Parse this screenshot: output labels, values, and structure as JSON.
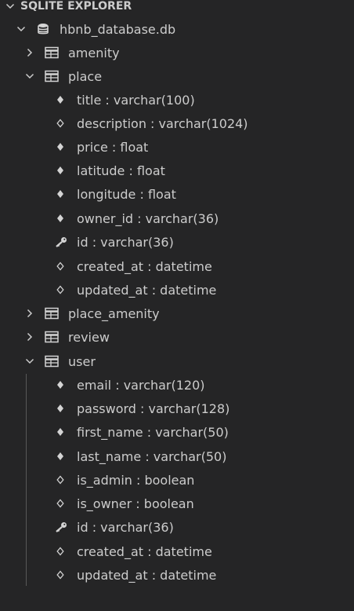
{
  "section": {
    "title": "SQLITE EXPLORER"
  },
  "database": {
    "name": "hbnb_database.db",
    "icon": "database-icon"
  },
  "tables": [
    {
      "name": "amenity",
      "expanded": false,
      "icon": "table-icon"
    },
    {
      "name": "place",
      "expanded": true,
      "icon": "table-icon",
      "columns": [
        {
          "label": "title : varchar(100)",
          "kind": "not-null"
        },
        {
          "label": "description : varchar(1024)",
          "kind": "nullable"
        },
        {
          "label": "price : float",
          "kind": "not-null"
        },
        {
          "label": "latitude : float",
          "kind": "not-null"
        },
        {
          "label": "longitude : float",
          "kind": "not-null"
        },
        {
          "label": "owner_id : varchar(36)",
          "kind": "not-null"
        },
        {
          "label": "id : varchar(36)",
          "kind": "primary-key"
        },
        {
          "label": "created_at : datetime",
          "kind": "nullable"
        },
        {
          "label": "updated_at : datetime",
          "kind": "nullable"
        }
      ]
    },
    {
      "name": "place_amenity",
      "expanded": false,
      "icon": "table-icon"
    },
    {
      "name": "review",
      "expanded": false,
      "icon": "table-icon"
    },
    {
      "name": "user",
      "expanded": true,
      "icon": "table-icon",
      "columns": [
        {
          "label": "email : varchar(120)",
          "kind": "not-null"
        },
        {
          "label": "password : varchar(128)",
          "kind": "not-null"
        },
        {
          "label": "first_name : varchar(50)",
          "kind": "not-null"
        },
        {
          "label": "last_name : varchar(50)",
          "kind": "not-null"
        },
        {
          "label": "is_admin : boolean",
          "kind": "nullable"
        },
        {
          "label": "is_owner : boolean",
          "kind": "nullable"
        },
        {
          "label": "id : varchar(36)",
          "kind": "primary-key"
        },
        {
          "label": "created_at : datetime",
          "kind": "nullable"
        },
        {
          "label": "updated_at : datetime",
          "kind": "nullable"
        }
      ]
    }
  ],
  "colors": {
    "background": "#252526",
    "text": "#cccccc",
    "icon": "#d4d4d4",
    "guide": "#585858"
  }
}
